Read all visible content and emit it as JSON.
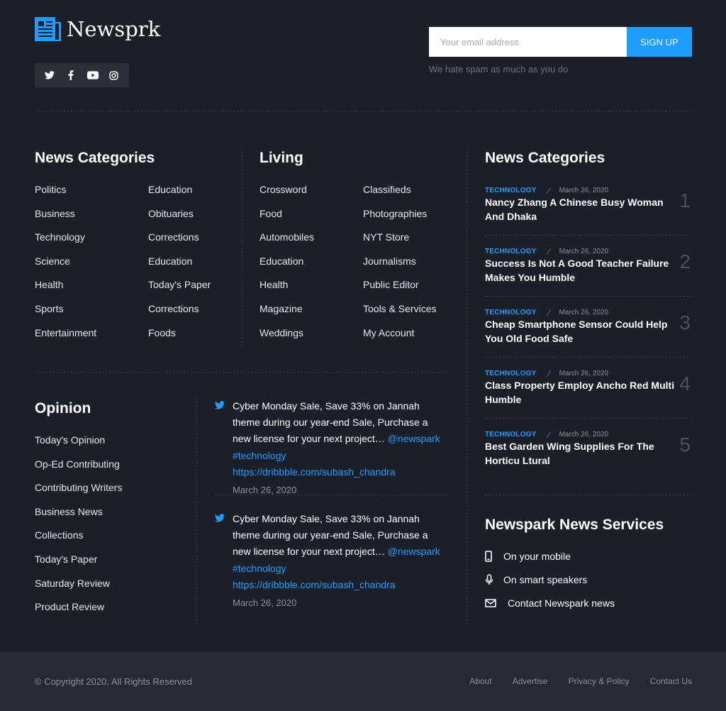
{
  "brand": {
    "name": "Newsprk",
    "accent": "#1e9cff"
  },
  "social": [
    {
      "name": "twitter-icon"
    },
    {
      "name": "facebook-icon"
    },
    {
      "name": "youtube-icon"
    },
    {
      "name": "instagram-icon"
    }
  ],
  "subscribe": {
    "placeholder": "Your email address",
    "button": "SIGN UP",
    "note": "We hate spam as much as you do"
  },
  "news_categories": {
    "title": "News Categories",
    "col1": [
      "Politics",
      "Business",
      "Technology",
      "Science",
      "Health",
      "Sports",
      "Entertainment"
    ],
    "col2": [
      "Education",
      "Obituaries",
      "Corrections",
      "Education",
      "Today's Paper",
      "Corrections",
      "Foods"
    ]
  },
  "living": {
    "title": "Living",
    "col1": [
      "Crossword",
      "Food",
      "Automobiles",
      "Education",
      "Health",
      "Magazine",
      "Weddings"
    ],
    "col2": [
      "Classifieds",
      "Photographies",
      "NYT Store",
      "Journalisms",
      "Public Editor",
      "Tools & Services",
      "My Account"
    ]
  },
  "opinion": {
    "title": "Opinion",
    "items": [
      "Today's Opinion",
      "Op-Ed Contributing",
      "Contributing Writers",
      "Business News",
      "Collections",
      "Today's Paper",
      "Saturday Review",
      "Product Review"
    ]
  },
  "tweets": [
    {
      "text": "Cyber Monday Sale, Save 33% on Jannah theme during our year-end Sale, Purchase a new license for your next project…",
      "handle": "@newspark #technology",
      "url": "https://dribbble.com/subash_chandra",
      "date": "March 26, 2020"
    },
    {
      "text": "Cyber Monday Sale, Save 33% on Jannah theme during our year-end Sale, Purchase a new license for your next project…",
      "handle": "@newspark #technology",
      "url": "https://dribbble.com/subash_chandra",
      "date": "March 26, 2020"
    }
  ],
  "ranked": {
    "title": "News Categories",
    "items": [
      {
        "category": "TECHNOLOGY",
        "date": "March 26, 2020",
        "title": "Nancy Zhang A Chinese Busy Woman And Dhaka",
        "num": "1"
      },
      {
        "category": "TECHNOLOGY",
        "date": "March 26, 2020",
        "title": "Success Is Not A Good Teacher Failure Makes You Humble",
        "num": "2"
      },
      {
        "category": "TECHNOLOGY",
        "date": "March 26, 2020",
        "title": "Cheap Smartphone Sensor Could Help You Old Food Safe",
        "num": "3"
      },
      {
        "category": "TECHNOLOGY",
        "date": "March 26, 2020",
        "title": "Class Property Employ Ancho Red Multi Humble",
        "num": "4"
      },
      {
        "category": "TECHNOLOGY",
        "date": "March 26, 2020",
        "title": "Best Garden Wing Supplies For The Horticu Ltural",
        "num": "5"
      }
    ]
  },
  "services": {
    "title": "Newspark News Services",
    "items": [
      {
        "icon": "mobile-icon",
        "label": "On your mobile"
      },
      {
        "icon": "microphone-icon",
        "label": "On smart speakers"
      },
      {
        "icon": "envelope-icon",
        "label": "Contact Newspark news"
      }
    ]
  },
  "footer": {
    "copyright": "© Copyright 2020, All Rights Reserved",
    "links": [
      "About",
      "Advertise",
      "Privacy & Policy",
      "Contact Us"
    ]
  }
}
